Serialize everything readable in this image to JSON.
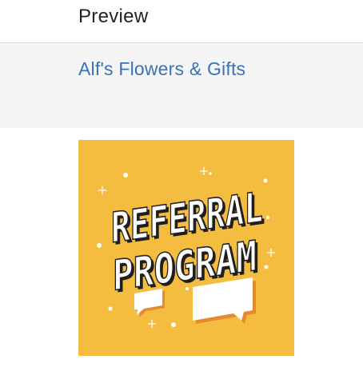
{
  "header": {
    "title": "Preview"
  },
  "email": {
    "sender_name": "Alf's Flowers & Gifts"
  },
  "promo": {
    "line1": "REFERRAL",
    "line2": "PROGRAM",
    "background_color": "#f5bd3f",
    "accent_color": "#e68a2e",
    "text_fill_color": "#ffffff",
    "text_outline_color": "#1f1f1f",
    "icons": [
      "sparkle-icon",
      "speech-bubble-icon"
    ]
  }
}
